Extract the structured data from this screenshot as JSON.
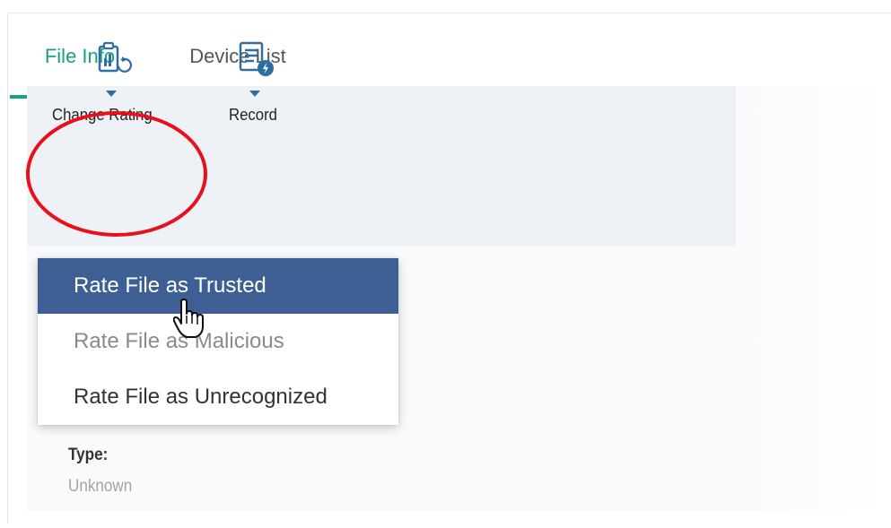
{
  "tabs": [
    {
      "label": "File Info",
      "active": true
    },
    {
      "label": "Device List",
      "active": false
    }
  ],
  "toolbar": {
    "change_rating": {
      "label": "Change Rating",
      "icon": "change-rating-icon"
    },
    "record": {
      "label": "Record",
      "icon": "record-icon"
    }
  },
  "dropdown": {
    "items": [
      {
        "label": "Rate File as Trusted",
        "state": "highlighted"
      },
      {
        "label": "Rate File as Malicious",
        "state": "disabled"
      },
      {
        "label": "Rate File as Unrecognized",
        "state": "normal"
      }
    ]
  },
  "details": {
    "type_label": "Type:",
    "type_value": "Unknown"
  },
  "colors": {
    "accent_green": "#1f9e84",
    "menu_highlight": "#3d5f94",
    "icon_blue": "#2d6ea3",
    "annotation_red": "#e8101b"
  },
  "cursor": "hand-pointer-icon"
}
